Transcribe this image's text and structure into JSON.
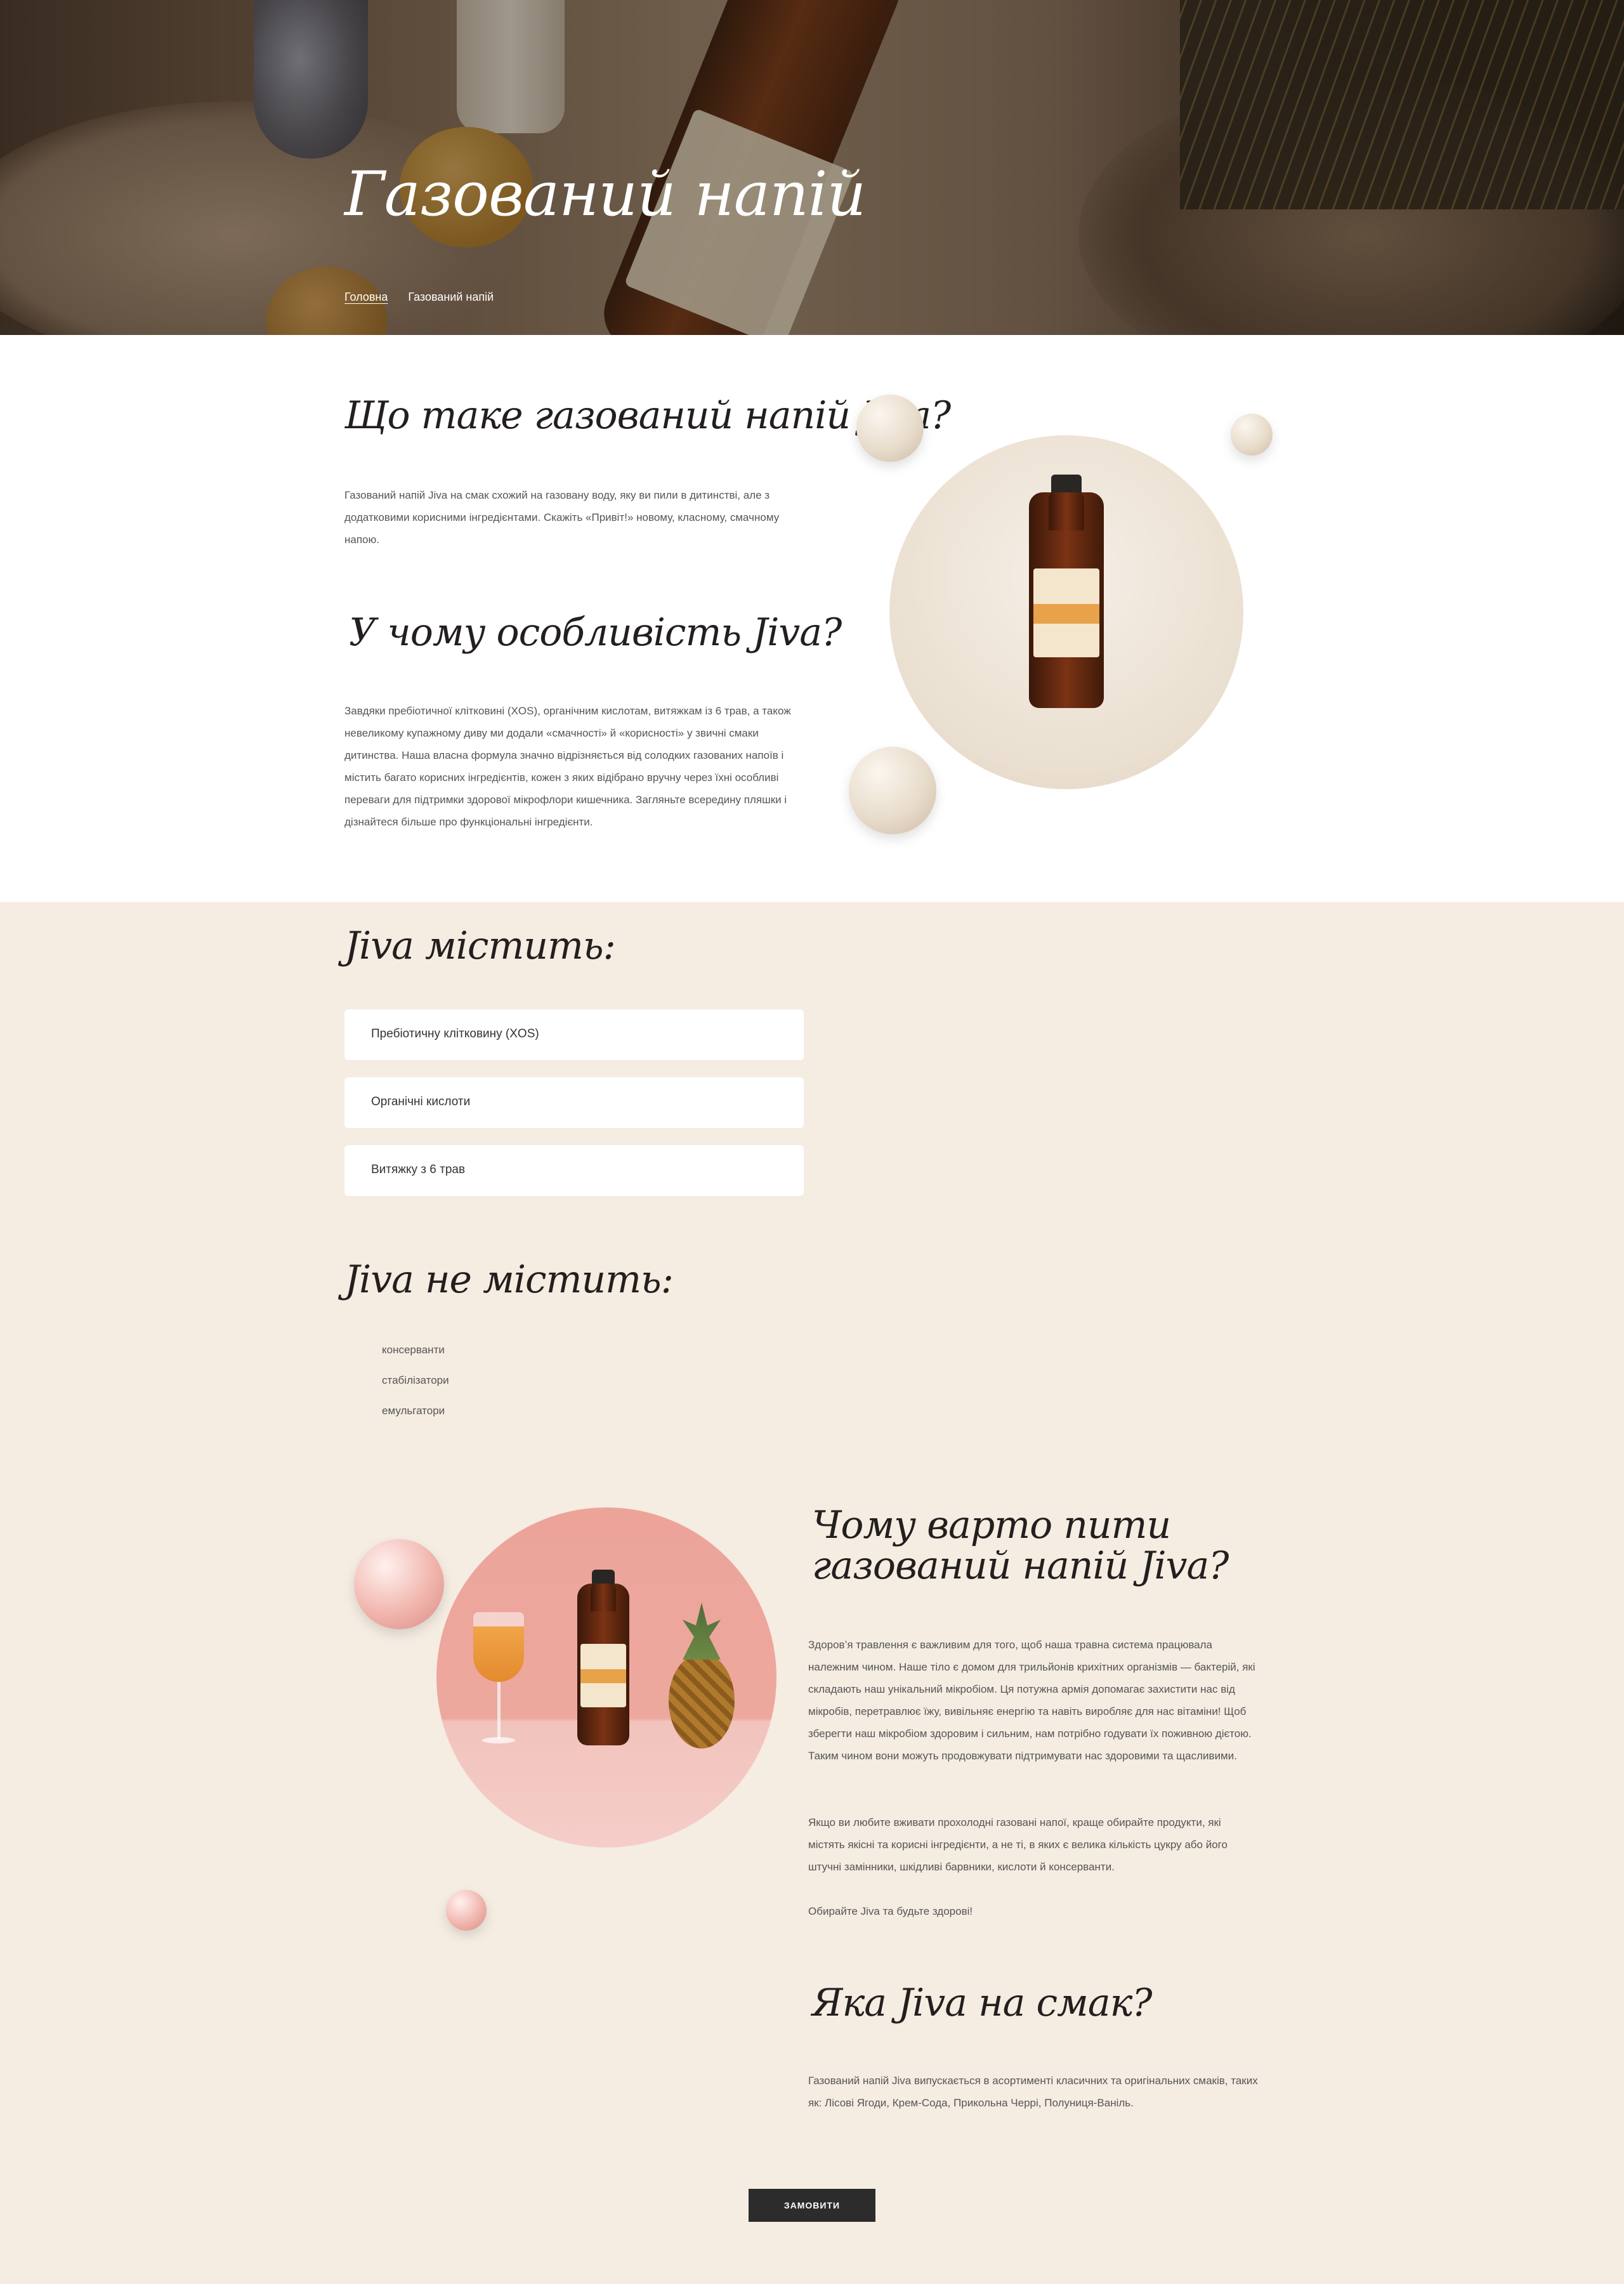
{
  "hero": {
    "title": "Газований напій",
    "breadcrumbs": [
      "Головна",
      "Газований напій"
    ]
  },
  "about": {
    "heading": "Що таке газований напій Jiva?",
    "text": "Газований напій Jiva на смак схожий на газовану воду, яку ви пили в дитинстві, але з додатковими корисними інгредієнтами. Скажіть «Привіт!» новому, класному, смачному напою.",
    "feature_heading": "У чому особливість Jiva?",
    "feature_text": "Завдяки пребіотичної клітковині (XOS), органічним кислотам, витяжкам із 6 трав, а також невеликому купажному диву ми додали «смачності» й «корисності» у звичні смаки дитинства. Наша власна формула значно відрізняється від солодких газованих напоїв і містить багато корисних інгредієнтів, кожен з яких відібрано вручну через їхні особливі переваги для підтримки здорової мікрофлори кишечника. Загляньте всередину пляшки і дізнайтеся більше про функціональні інгредієнти."
  },
  "contains": {
    "heading": "Jiva містить:",
    "items": [
      "Пребіотичну клітковину (XOS)",
      "Органічні кислоти",
      "Витяжку з 6 трав"
    ]
  },
  "not_contains": {
    "heading": "Jiva не містить:",
    "items": [
      "консерванти",
      "стабілізатори",
      "емульгатори"
    ]
  },
  "why": {
    "heading": "Чому варто пити газований напій Jiva?",
    "paragraphs": [
      "Здоров’я травлення є важливим для того, щоб наша травна система працювала належним чином. Наше тіло є домом для трильйонів крихітних організмів — бактерій, які складають наш унікальний мікробіом. Ця потужна армія допомагає захистити нас від мікробів, перетравлює їжу, вивільняє енергію та навіть виробляє для нас вітаміни! Щоб зберегти наш мікробіом здоровим і сильним, нам потрібно годувати їх поживною дієтою. Таким чином вони можуть продовжувати підтримувати нас здоровими та щасливими.",
      "Якщо ви любите вживати прохолодні газовані напої, краще обирайте продукти, які містять якісні та корисні інгредієнти, а не ті, в яких є велика кількість цукру або його штучні замінники, шкідливі барвники, кислоти й консерванти.",
      "Обирайте Jiva та будьте здорові!"
    ]
  },
  "taste": {
    "heading": "Яка Jiva на смак?",
    "text": "Газований напій Jiva випускається в асортименті класичних та оригінальних смаків, таких як: Лісові Ягоди, Крем-Сода, Прикольна Черрі, Полуниця-Ваніль."
  },
  "cta": {
    "label": "ЗАМОВИТИ"
  },
  "colors": {
    "beige": "#f5ece2",
    "dark": "#2c2c2c",
    "pink": "#eea79d",
    "cream": "#efe5d8"
  }
}
